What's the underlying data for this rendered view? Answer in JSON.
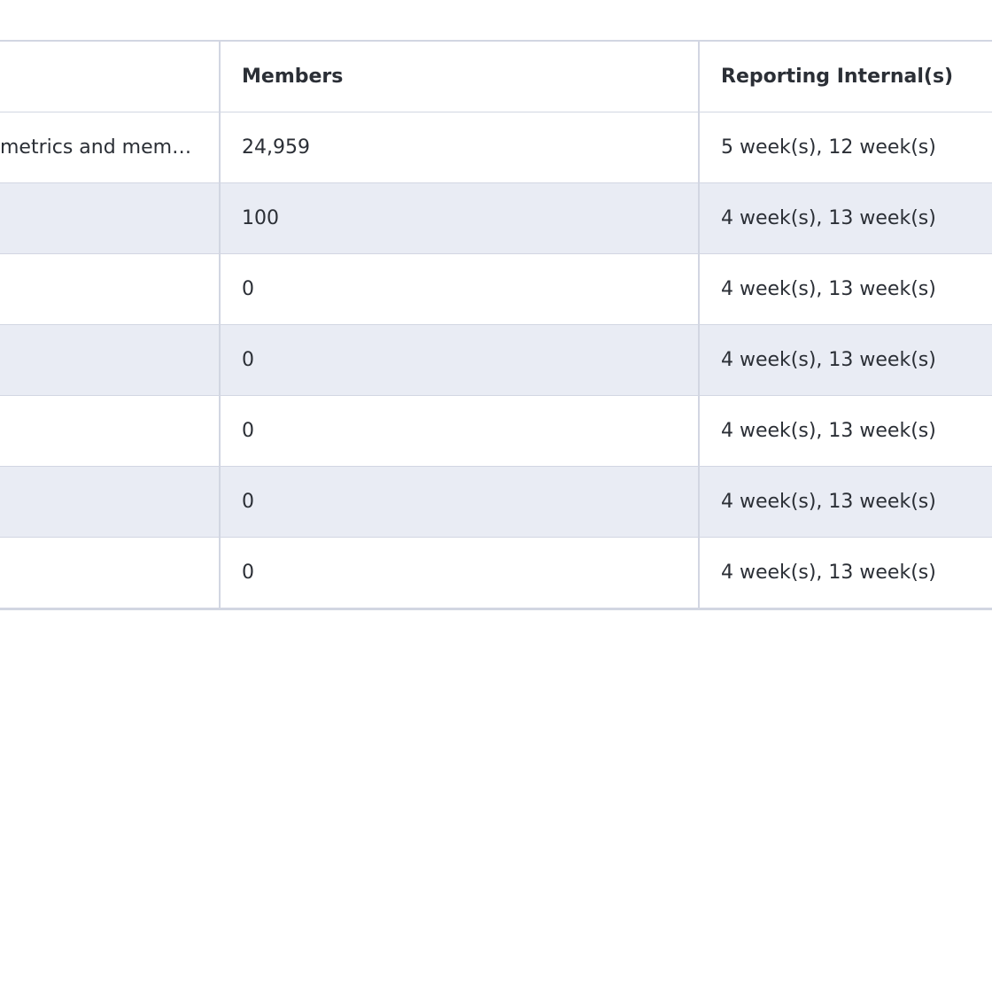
{
  "table": {
    "headers": {
      "description": "",
      "members": "Members",
      "interval": "Reporting Internal(s)"
    },
    "rows": [
      {
        "description": "metrics and member...",
        "members": "24,959",
        "interval": "5 week(s), 12 week(s)"
      },
      {
        "description": "",
        "members": "100",
        "interval": "4 week(s), 13 week(s)"
      },
      {
        "description": "",
        "members": "0",
        "interval": "4 week(s), 13 week(s)"
      },
      {
        "description": "",
        "members": "0",
        "interval": "4 week(s), 13 week(s)"
      },
      {
        "description": "",
        "members": "0",
        "interval": "4 week(s), 13 week(s)"
      },
      {
        "description": "",
        "members": "0",
        "interval": "4 week(s), 13 week(s)"
      },
      {
        "description": "",
        "members": "0",
        "interval": "4 week(s), 13 week(s)"
      }
    ]
  }
}
